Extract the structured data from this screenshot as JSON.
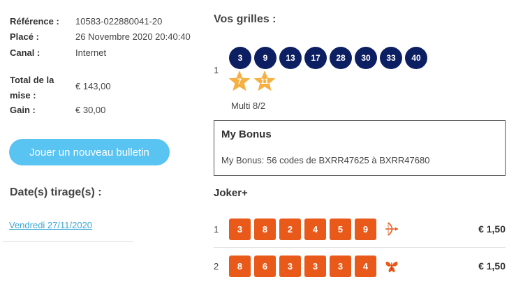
{
  "details": {
    "reference_label": "Référence :",
    "reference_value": "10583-022880041-20",
    "placed_label": "Placé :",
    "placed_value": "26 Novembre 2020 20:40:40",
    "channel_label": "Canal :",
    "channel_value": "Internet",
    "total_label": "Total de la mise :",
    "total_value": "€ 143,00",
    "gain_label": "Gain :",
    "gain_value": "€ 30,00"
  },
  "actions": {
    "new_bet_label": "Jouer un nouveau bulletin"
  },
  "draws": {
    "title": "Date(s) tirage(s) :",
    "dates": [
      "Vendredi 27/11/2020"
    ]
  },
  "grids": {
    "title": "Vos grilles :",
    "items": [
      {
        "index": "1",
        "numbers": [
          "3",
          "9",
          "13",
          "17",
          "28",
          "30",
          "33",
          "40"
        ],
        "stars": [
          "7",
          "11"
        ],
        "type": "Multi 8/2"
      }
    ]
  },
  "bonus": {
    "title": "My Bonus",
    "text": "My Bonus: 56 codes de BXRR47625 à BXRR47680"
  },
  "joker": {
    "title": "Joker+",
    "rows": [
      {
        "index": "1",
        "digits": [
          "3",
          "8",
          "2",
          "4",
          "5",
          "9"
        ],
        "icon": "bow-arrow-icon",
        "price": "€ 1,50"
      },
      {
        "index": "2",
        "digits": [
          "8",
          "6",
          "3",
          "3",
          "3",
          "4"
        ],
        "icon": "butterfly-icon",
        "price": "€ 1,50"
      }
    ]
  },
  "colors": {
    "ball": "#0d1f63",
    "star": "#f5b041",
    "joker": "#e8591a",
    "button": "#59c3f2",
    "link": "#3aa7d6"
  }
}
